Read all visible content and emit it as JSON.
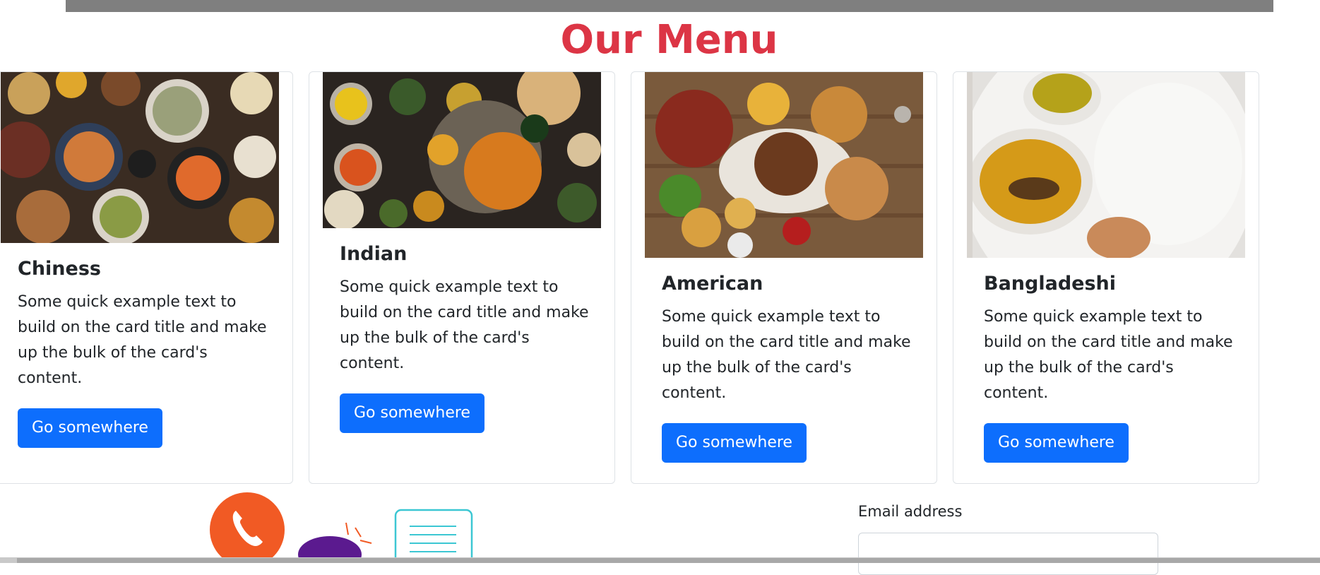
{
  "section": {
    "title": "Our Menu"
  },
  "cards": [
    {
      "title": "Chiness",
      "text": "Some quick example text to build on the card title and make up the bulk of the card's content.",
      "button": "Go somewhere",
      "image_icon": "asian-dishes-photo"
    },
    {
      "title": "Indian",
      "text": "Some quick example text to build on the card title and make up the bulk of the card's content.",
      "button": "Go somewhere",
      "image_icon": "indian-dishes-photo"
    },
    {
      "title": "American",
      "text": "Some quick example text to build on the card title and make up the bulk of the card's content.",
      "button": "Go somewhere",
      "image_icon": "american-platter-photo"
    },
    {
      "title": "Bangladeshi",
      "text": "Some quick example text to build on the card title and make up the bulk of the card's content.",
      "button": "Go somewhere",
      "image_icon": "bangladeshi-fish-rice-photo"
    }
  ],
  "contact": {
    "email_label": "Email address"
  },
  "colors": {
    "title": "#dc3545",
    "button": "#0d6efd",
    "phone": "#f15a24",
    "chat": "#5b1a8f",
    "note": "#3cc7d3"
  }
}
